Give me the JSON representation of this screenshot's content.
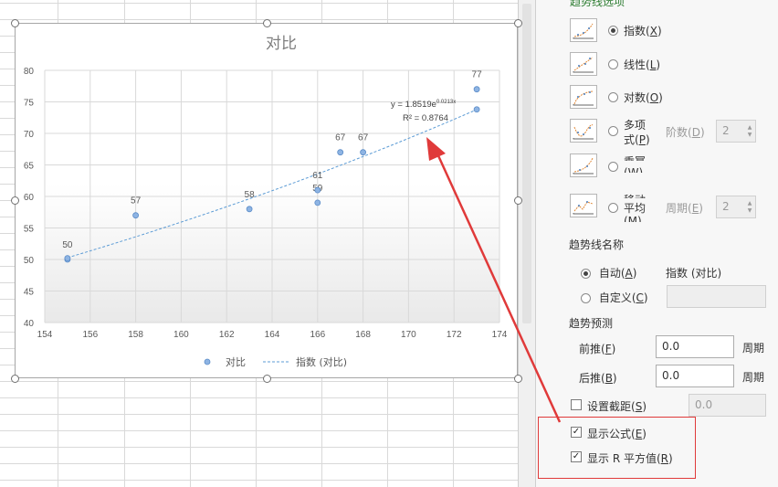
{
  "chart": {
    "title": "对比",
    "equation_main": "y = 1.8519e",
    "equation_exp": "0.0213x",
    "r_squared": "R² = 0.8764",
    "legend_series": "对比",
    "legend_trend": "指数 (对比)"
  },
  "chart_data": {
    "type": "scatter",
    "title": "对比",
    "xlim": [
      154,
      174
    ],
    "ylim": [
      40,
      80
    ],
    "x_ticks": [
      154,
      156,
      158,
      160,
      162,
      164,
      166,
      168,
      170,
      172,
      174
    ],
    "y_ticks": [
      40,
      45,
      50,
      55,
      60,
      65,
      70,
      75,
      80
    ],
    "grid": true,
    "legend_placement": "bottom",
    "series": [
      {
        "name": "对比",
        "color": "#8eb4e3",
        "x": [
          155,
          155,
          158,
          163,
          166,
          166,
          167,
          168,
          173,
          173
        ],
        "y": [
          50,
          50.2,
          57,
          58,
          59,
          61,
          67,
          67,
          77,
          73.8
        ],
        "labels": [
          "50",
          "",
          "57",
          "58",
          "59",
          "61",
          "67",
          "67",
          "77",
          ""
        ]
      }
    ],
    "trendline": {
      "name": "指数 (对比)",
      "type": "exponential",
      "a": 1.8519,
      "b": 0.0213,
      "x_range": [
        155,
        173
      ],
      "color": "#5b9bd5"
    }
  },
  "panel": {
    "header_partial": "趋势线选项",
    "options": [
      {
        "label": "指数",
        "key": "X",
        "selected": true
      },
      {
        "label": "线性",
        "key": "L",
        "selected": false
      },
      {
        "label": "对数",
        "key": "O",
        "selected": false
      },
      {
        "label": "多项式",
        "key": "P",
        "selected": false
      },
      {
        "label": "乘幂",
        "key": "W",
        "selected": false
      },
      {
        "label": "移动平均",
        "key": "M",
        "selected": false
      }
    ],
    "poly": {
      "label": "多项",
      "label2": "式(",
      "key": "P",
      "order_label": "阶数(",
      "order_key": "D",
      "order_value": "2"
    },
    "power": {
      "label": "乘幂",
      "label2": "(W)"
    },
    "moving": {
      "label": "移动",
      "label2": "平均",
      "label3": "(M)",
      "period_label": "周期(",
      "period_key": "E",
      "period_value": "2"
    },
    "name_section": {
      "title": "趋势线名称",
      "auto_label": "自动(",
      "auto_key": "A",
      "auto_value": "指数 (对比)",
      "custom_label": "自定义(",
      "custom_key": "C",
      "custom_value": ""
    },
    "forecast": {
      "title": "趋势预测",
      "forward_label": "前推(",
      "forward_key": "F",
      "forward_value": "0.0",
      "backward_label": "后推(",
      "backward_key": "B",
      "backward_value": "0.0",
      "unit": "周期"
    },
    "intercept": {
      "label": "设置截距(",
      "key": "S",
      "value": "0.0",
      "checked": false
    },
    "show_equation": {
      "label": "显示公式(",
      "key": "E",
      "checked": true
    },
    "show_r2": {
      "label": "显示 R 平方值(",
      "key": "R",
      "checked": true
    }
  },
  "colors": {
    "annotation_red": "#e03a3a",
    "point_fill": "#8eb4e3",
    "trend": "#5b9bd5"
  }
}
